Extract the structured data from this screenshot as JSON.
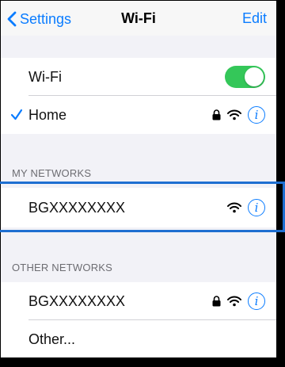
{
  "nav": {
    "back_label": "Settings",
    "title": "Wi-Fi",
    "edit_label": "Edit"
  },
  "wifi_row": {
    "label": "Wi-Fi",
    "toggle_on": true,
    "toggle_color": "#34c759"
  },
  "current_network": {
    "name": "Home",
    "secured": true,
    "icons": [
      "lock-icon",
      "wifi-icon",
      "info-icon"
    ]
  },
  "my_networks": {
    "header": "MY NETWORKS",
    "items": [
      {
        "name": "BGXXXXXXXX",
        "secured": false,
        "icons": [
          "wifi-icon",
          "info-icon"
        ]
      }
    ]
  },
  "other_networks": {
    "header": "OTHER NETWORKS",
    "items": [
      {
        "name": "BGXXXXXXXX",
        "secured": true,
        "icons": [
          "lock-icon",
          "wifi-icon",
          "info-icon"
        ]
      },
      {
        "name": "Other...",
        "icons": []
      }
    ]
  },
  "colors": {
    "accent": "#0a7cff",
    "highlight_box": "#1e6fd1",
    "background": "#f2f2f7"
  }
}
